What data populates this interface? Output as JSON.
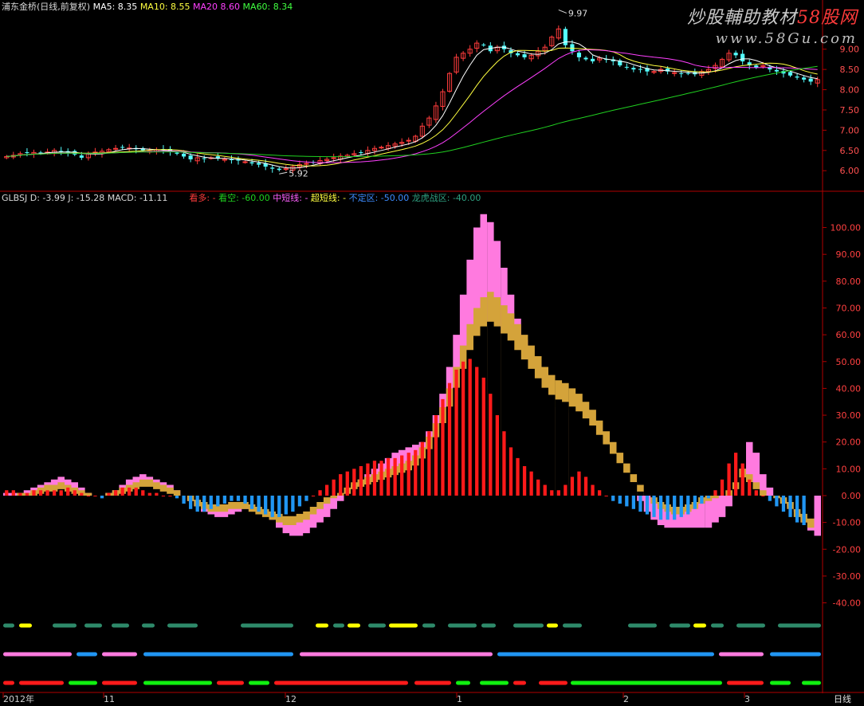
{
  "colors": {
    "up": "#ff3c3c",
    "down": "#54ffff",
    "ma5": "#ffffff",
    "ma10": "#ffff40",
    "ma20": "#ff40ff",
    "ma60": "#20d020",
    "grid": "#b00000",
    "pink": "#ff7adf",
    "gold": "#d4a33a",
    "bar_red": "#ff1a1a",
    "bar_blue": "#2196f3",
    "teal": "#2e8a6a",
    "yellow": "#ffff00",
    "green": "#10f010"
  },
  "header": {
    "stock": "浦东金桥(日线,前复权)",
    "ma5": "MA5: 8.35",
    "ma10": "MA10: 8.55",
    "ma20": "MA20  8.60",
    "ma60": "MA60: 8.34"
  },
  "indicator_header": {
    "main": "GLBSJ D: -3.99 J: -15.28 MACD: -11.11",
    "kanduo": "看多: -",
    "kankong": "看空: -60.00",
    "zhong": "中短线: -",
    "chao": "超短线: -",
    "buding": "不定区: -50.00",
    "longhu": "龙虎战区: -40.00"
  },
  "watermark": {
    "line1a": "炒股輔助教材",
    "line1b": "58股网",
    "line2": "www.58Gu.com"
  },
  "annotations": {
    "high": "9.97",
    "low": "5.92"
  },
  "x_axis": {
    "labels": [
      "2012年",
      "11",
      "12",
      "1",
      "2",
      "3"
    ],
    "period": "日线"
  },
  "chart_data": [
    {
      "type": "candlestick",
      "title": "浦东金桥(日线,前复权)",
      "y_ticks": [
        "9.00",
        "8.50",
        "8.00",
        "7.50",
        "7.00",
        "6.50",
        "6.00"
      ],
      "y_tick_values": [
        9.0,
        8.5,
        8.0,
        7.5,
        7.0,
        6.5,
        6.0
      ],
      "ylim": [
        5.65,
        9.9
      ],
      "high_label": 9.97,
      "low_label": 5.92,
      "close_approx": [
        6.35,
        6.38,
        6.42,
        6.44,
        6.45,
        6.43,
        6.46,
        6.5,
        6.47,
        6.45,
        6.4,
        6.32,
        6.42,
        6.46,
        6.48,
        6.52,
        6.55,
        6.58,
        6.56,
        6.53,
        6.5,
        6.48,
        6.52,
        6.5,
        6.47,
        6.42,
        6.35,
        6.28,
        6.32,
        6.3,
        6.32,
        6.3,
        6.28,
        6.26,
        6.25,
        6.22,
        6.18,
        6.15,
        6.1,
        6.05,
        6.02,
        6.05,
        6.1,
        6.15,
        6.18,
        6.2,
        6.25,
        6.28,
        6.32,
        6.36,
        6.38,
        6.42,
        6.45,
        6.5,
        6.55,
        6.58,
        6.62,
        6.66,
        6.7,
        6.75,
        6.85,
        7.1,
        7.3,
        7.6,
        7.95,
        8.4,
        8.8,
        8.9,
        9.0,
        9.15,
        9.1,
        8.95,
        9.05,
        9.0,
        8.9,
        8.85,
        8.8,
        8.85,
        8.95,
        9.05,
        9.3,
        9.5,
        9.1,
        8.95,
        8.8,
        8.75,
        8.7,
        8.78,
        8.75,
        8.7,
        8.6,
        8.55,
        8.5,
        8.5,
        8.45,
        8.45,
        8.5,
        8.45,
        8.42,
        8.4,
        8.4,
        8.38,
        8.45,
        8.5,
        8.6,
        8.75,
        8.9,
        8.85,
        8.7,
        8.6,
        8.55,
        8.6,
        8.5,
        8.45,
        8.4,
        8.35,
        8.3,
        8.25,
        8.2,
        8.25
      ]
    },
    {
      "type": "bar",
      "title": "GLBSJ",
      "y_ticks": [
        "100.00",
        "90.00",
        "80.00",
        "70.00",
        "60.00",
        "50.00",
        "40.00",
        "30.00",
        "20.00",
        "10.00",
        "0.00",
        "-10.00",
        "-20.00",
        "-30.00",
        "-40.00"
      ],
      "y_tick_values": [
        100,
        90,
        80,
        70,
        60,
        50,
        40,
        30,
        20,
        10,
        0,
        -10,
        -20,
        -30,
        -40
      ],
      "ylim": [
        -44,
        107
      ],
      "pink_top": [
        1,
        1,
        1,
        2,
        3,
        4,
        5,
        6,
        7,
        6,
        5,
        3,
        1,
        0,
        0,
        1,
        2,
        4,
        6,
        7,
        8,
        7,
        6,
        5,
        4,
        2,
        0,
        -2,
        -4,
        -6,
        -7,
        -8,
        -8,
        -7,
        -6,
        -5,
        -5,
        -6,
        -7,
        -9,
        -12,
        -14,
        -15,
        -15,
        -14,
        -12,
        -10,
        -8,
        -5,
        -2,
        1,
        4,
        6,
        8,
        10,
        12,
        14,
        16,
        17,
        18,
        19,
        20,
        24,
        30,
        38,
        48,
        60,
        75,
        88,
        100,
        105,
        102,
        95,
        85,
        75,
        66,
        58,
        50,
        45,
        40,
        36,
        33,
        32,
        31,
        30,
        28,
        26,
        22,
        18,
        14,
        10,
        6,
        2,
        -2,
        -6,
        -9,
        -11,
        -12,
        -12,
        -12,
        -12,
        -12,
        -12,
        -12,
        -10,
        -8,
        -4,
        2,
        10,
        20,
        16,
        8,
        3,
        0,
        -2,
        -4,
        -6,
        -10,
        -13,
        -15
      ],
      "gold_top": [
        0,
        0,
        1,
        1,
        2,
        3,
        4,
        4,
        5,
        4,
        3,
        2,
        1,
        0,
        0,
        1,
        2,
        3,
        4,
        5,
        6,
        6,
        5,
        4,
        3,
        2,
        0,
        -2,
        -4,
        -5,
        -6,
        -6,
        -6,
        -5,
        -5,
        -5,
        -6,
        -7,
        -8,
        -9,
        -10,
        -11,
        -11,
        -10,
        -9,
        -7,
        -5,
        -3,
        -1,
        1,
        3,
        5,
        6,
        7,
        8,
        9,
        10,
        11,
        12,
        13,
        15,
        18,
        22,
        27,
        33,
        40,
        48,
        56,
        64,
        70,
        74,
        76,
        74,
        71,
        68,
        64,
        60,
        56,
        52,
        48,
        45,
        43,
        42,
        40,
        38,
        35,
        32,
        28,
        24,
        20,
        16,
        12,
        8,
        4,
        0,
        -3,
        -5,
        -6,
        -7,
        -7,
        -6,
        -5,
        -3,
        -2,
        -1,
        0,
        2,
        5,
        10,
        8,
        5,
        2,
        0,
        -1,
        -3,
        -5,
        -8,
        -10,
        -12
      ],
      "macd_bars": [
        2,
        2,
        1,
        1,
        2,
        2,
        2,
        2,
        2,
        3,
        2,
        1,
        0,
        0,
        -1,
        1,
        2,
        3,
        3,
        3,
        2,
        1,
        1,
        0,
        0,
        -1,
        -3,
        -5,
        -6,
        -6,
        -5,
        -4,
        -3,
        -2,
        -2,
        -3,
        -5,
        -6,
        -7,
        -8,
        -8,
        -7,
        -6,
        -4,
        -2,
        0,
        2,
        4,
        6,
        8,
        9,
        10,
        11,
        12,
        13,
        13,
        14,
        14,
        15,
        16,
        17,
        20,
        24,
        30,
        36,
        42,
        47,
        50,
        51,
        48,
        44,
        38,
        30,
        24,
        18,
        14,
        11,
        9,
        6,
        4,
        2,
        2,
        4,
        7,
        9,
        7,
        4,
        2,
        0,
        -2,
        -3,
        -4,
        -5,
        -6,
        -7,
        -8,
        -9,
        -9,
        -9,
        -8,
        -7,
        -5,
        -3,
        -1,
        2,
        6,
        12,
        16,
        12,
        6,
        2,
        0,
        -2,
        -4,
        -6,
        -8,
        -10,
        -11
      ],
      "series": [
        {
          "name": "看空",
          "values": [
            -60
          ]
        },
        {
          "name": "不定区",
          "values": [
            -50
          ]
        },
        {
          "name": "龙虎战区",
          "values": [
            -40
          ]
        }
      ]
    }
  ]
}
